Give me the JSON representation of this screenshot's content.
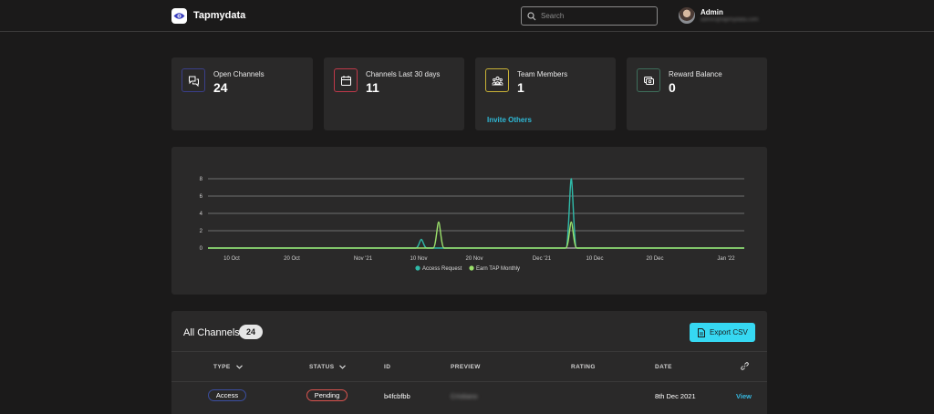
{
  "app": {
    "brand": "Tapmydata"
  },
  "search": {
    "placeholder": "Search"
  },
  "user": {
    "name": "Admin",
    "email": "admin@tapmydata.com"
  },
  "stats": [
    {
      "label": "Open Channels",
      "value": "24",
      "icon": "chat-bubbles-icon",
      "color": "#3a3f8a"
    },
    {
      "label": "Channels Last 30 days",
      "value": "11",
      "icon": "calendar-icon",
      "color": "#c0394a"
    },
    {
      "label": "Team Members",
      "value": "1",
      "icon": "team-icon",
      "color": "#c9b236",
      "link": "Invite Others"
    },
    {
      "label": "Reward Balance",
      "value": "0",
      "icon": "coins-icon",
      "color": "#3e6f5b"
    }
  ],
  "chart_data": {
    "type": "line",
    "x_ticks": [
      "10 Oct",
      "20 Oct",
      "Nov '21",
      "10 Nov",
      "20 Nov",
      "Dec '21",
      "10 Dec",
      "20 Dec",
      "Jan '22"
    ],
    "y_ticks": [
      "0",
      "2",
      "4",
      "6",
      "8"
    ],
    "ylim": [
      0,
      8
    ],
    "x_start": "2021-10-06",
    "x_end": "2022-01-07",
    "grid": true,
    "legend": "bottom-center",
    "series": [
      {
        "name": "Access Request",
        "color": "#2fb9a8",
        "points": [
          [
            "2021-11-12",
            1
          ],
          [
            "2021-12-08",
            8
          ]
        ]
      },
      {
        "name": "Earn TAP Monthly",
        "color": "#9be06b",
        "points": [
          [
            "2021-11-15",
            3
          ],
          [
            "2021-12-08",
            3
          ]
        ]
      }
    ]
  },
  "table": {
    "title": "All Channels",
    "count": "24",
    "export_label": "Export CSV",
    "columns": {
      "type": "TYPE",
      "status": "STATUS",
      "id": "ID",
      "preview": "PREVIEW",
      "rating": "RATING",
      "date": "DATE"
    },
    "rows": [
      {
        "type": "Access",
        "status": "Pending",
        "id": "b4fcbfbb",
        "preview": "Cristiano",
        "rating": "",
        "date": "8th Dec 2021",
        "action": "View"
      }
    ]
  }
}
